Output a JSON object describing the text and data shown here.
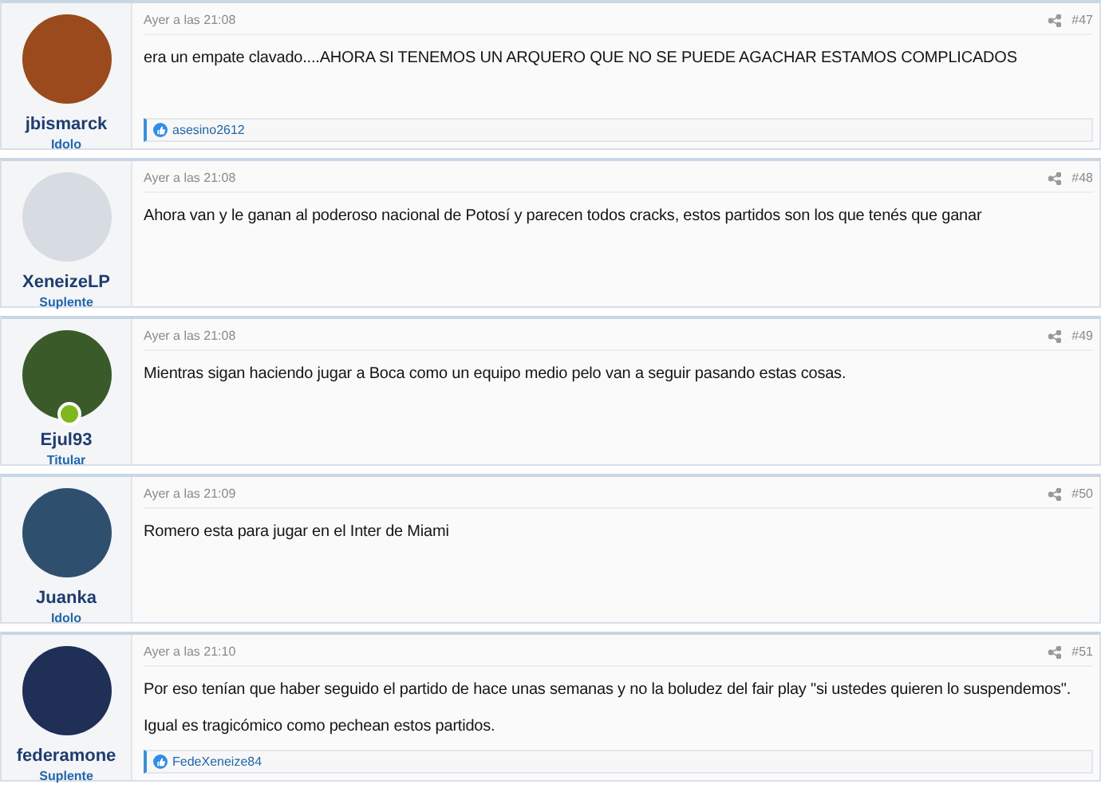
{
  "posts": [
    {
      "user": {
        "name": "jbismarck",
        "rank": "Idolo",
        "online": false
      },
      "date": "Ayer a las 21:08",
      "number": "#47",
      "body": [
        "era un empate clavado....AHORA SI TENEMOS UN ARQUERO QUE NO SE PUEDE AGACHAR ESTAMOS COMPLICADOS"
      ],
      "reactions": "asesino2612"
    },
    {
      "user": {
        "name": "XeneizeLP",
        "rank": "Suplente",
        "online": false
      },
      "date": "Ayer a las 21:08",
      "number": "#48",
      "body": [
        "Ahora van y le ganan al poderoso nacional de Potosí y parecen todos cracks, estos partidos son los que tenés que ganar"
      ]
    },
    {
      "user": {
        "name": "Ejul93",
        "rank": "Titular",
        "online": true
      },
      "date": "Ayer a las 21:08",
      "number": "#49",
      "body": [
        "Mientras sigan haciendo jugar a Boca como un equipo medio pelo van a seguir pasando estas cosas."
      ]
    },
    {
      "user": {
        "name": "Juanka",
        "rank": "Idolo",
        "online": false
      },
      "date": "Ayer a las 21:09",
      "number": "#50",
      "body": [
        "Romero esta para jugar en el Inter de Miami"
      ]
    },
    {
      "user": {
        "name": "federamone",
        "rank": "Suplente",
        "online": false
      },
      "date": "Ayer a las 21:10",
      "number": "#51",
      "body": [
        "Por eso tenían que haber seguido el partido de hace unas semanas y no la boludez del fair play \"si ustedes quieren lo suspendemos\".",
        "Igual es tragicómico como pechean estos partidos."
      ],
      "reactions": "FedeXeneize84"
    }
  ]
}
